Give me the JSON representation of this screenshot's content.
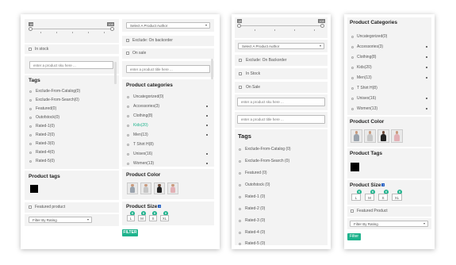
{
  "colors": {
    "accent": "#1fb38d",
    "kids_highlight": "#1fb38d",
    "tag_swatch": "#000000"
  },
  "price_slider": {
    "min_badge": "18",
    "max_badge": "108"
  },
  "panel1": {
    "left": {
      "in_stock": "In stock",
      "sku_placeholder": "enter a product sku here ...",
      "tags_heading": "Tags",
      "tags": [
        "Exclude-From-Catalog(0)",
        "Exclude-From-Search(0)",
        "Featured(0)",
        "Outofstock(0)",
        "Rated-1(0)",
        "Rated-2(0)",
        "Rated-3(0)",
        "Rated-4(0)",
        "Rated-5(0)"
      ],
      "product_tags_heading": "Product tags",
      "featured_product": "Featured product",
      "filter_by_rating": "Filter By Rating"
    },
    "right": {
      "author_select": "Select A Product Author",
      "exclude_backorder": "Exclude: On backorder",
      "on_sale": "On sale",
      "title_placeholder": "enter a product title here ...",
      "categories_heading": "Product categories",
      "categories": [
        "Uncategorized(0)",
        "Accessories(3)",
        "Clothing(8)",
        "Kids(20)",
        "Men(13)",
        "T Shirt H(8)",
        "Unisex(16)",
        "Women(13)"
      ],
      "color_heading": "Product Color",
      "size_heading": "Product Size",
      "sizes": [
        "L",
        "M",
        "S",
        "XL"
      ],
      "size_counts": [
        "6",
        "6",
        "6",
        "6"
      ],
      "filter_button": "FILTER"
    }
  },
  "panel2": {
    "author_select": "Select A Product Author",
    "exclude_backorder": "Exclude: On Backorder",
    "in_stock": "In Stock",
    "on_sale": "On Sale",
    "sku_placeholder": "enter a product sku here ...",
    "title_placeholder": "enter a product title here ...",
    "tags_heading": "Tags",
    "tags": [
      "Exclude-From-Catalog (0)",
      "Exclude-From-Search (0)",
      "Featured (0)",
      "Outofstock (0)",
      "Rated-1 (0)",
      "Rated-2 (0)",
      "Rated-3 (0)",
      "Rated-4 (0)",
      "Rated-5 (0)"
    ]
  },
  "panel3": {
    "categories_heading": "Product Categories",
    "categories": [
      "Uncategorized(0)",
      "Accessories(3)",
      "Clothing(8)",
      "Kids(20)",
      "Men(13)",
      "T Shirt H(8)",
      "Unisex(16)",
      "Women(13)"
    ],
    "color_heading": "Product Color",
    "tags_heading": "Product Tags",
    "size_heading": "Product Size",
    "sizes": [
      "L",
      "M",
      "S",
      "XL"
    ],
    "size_counts": [
      "6",
      "6",
      "6",
      "6"
    ],
    "featured_product": "Featured Product",
    "filter_by_rating": "Filter By Rating",
    "filter_button": "Filter"
  }
}
